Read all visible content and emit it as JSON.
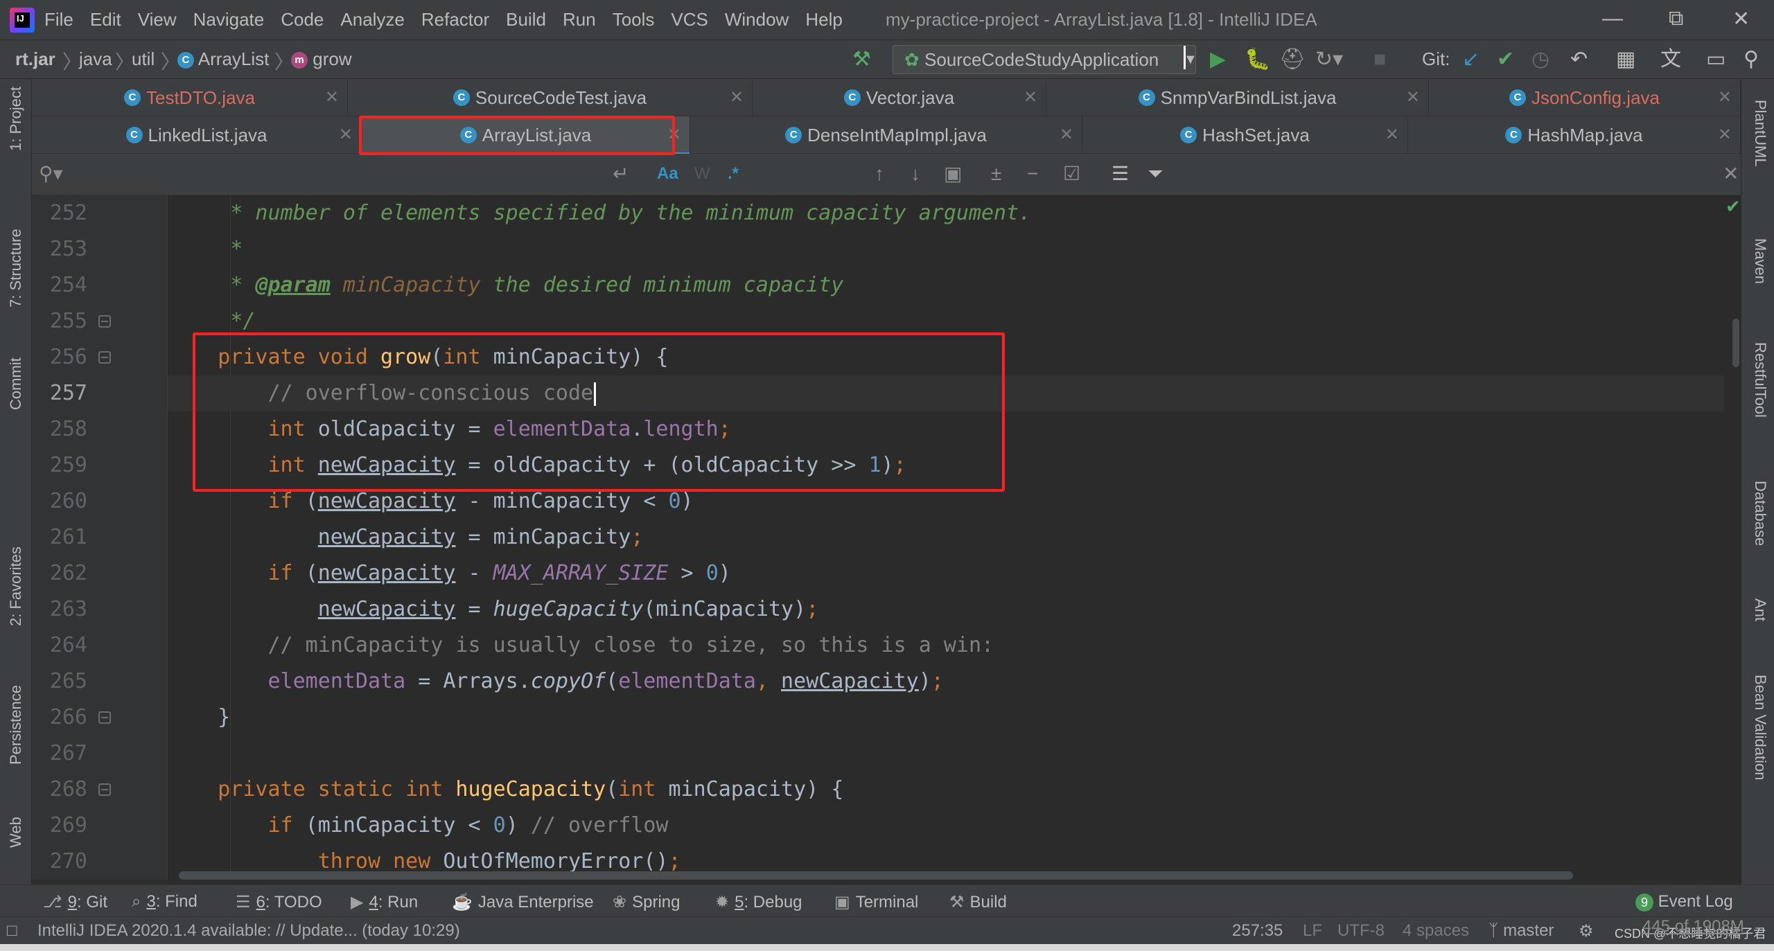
{
  "menubar": {
    "items": [
      "File",
      "Edit",
      "View",
      "Navigate",
      "Code",
      "Analyze",
      "Refactor",
      "Build",
      "Run",
      "Tools",
      "VCS",
      "Window",
      "Help"
    ],
    "window_title": "my-practice-project - ArrayList.java [1.8] - IntelliJ IDEA",
    "logo_text": "IJ"
  },
  "breadcrumb": {
    "items": [
      "rt.jar",
      "java",
      "util",
      "ArrayList",
      "grow"
    ]
  },
  "run_config": {
    "label": "SourceCodeStudyApplication"
  },
  "vcs_label": "Git:",
  "tabs_row1": [
    {
      "label": "TestDTO.java",
      "modified": true
    },
    {
      "label": "SourceCodeTest.java",
      "modified": false
    },
    {
      "label": "Vector.java",
      "modified": false
    },
    {
      "label": "SnmpVarBindList.java",
      "modified": false
    },
    {
      "label": "JsonConfig.java",
      "modified": true
    }
  ],
  "tabs_row2": [
    {
      "label": "LinkedList.java",
      "active": false
    },
    {
      "label": "ArrayList.java",
      "active": true
    },
    {
      "label": "DenseIntMapImpl.java",
      "active": false
    },
    {
      "label": "HashSet.java",
      "active": false
    },
    {
      "label": "HashMap.java",
      "active": false
    }
  ],
  "search": {
    "match_case_label": "Aa",
    "words_label": "W",
    "regex_label": ".*"
  },
  "left_tools": [
    "1: Project",
    "7: Structure",
    "Commit",
    "2: Favorites",
    "Persistence",
    "Web"
  ],
  "right_tools": [
    "PlantUML",
    "Maven",
    "RestfulTool",
    "Database",
    "Ant",
    "Bean Validation"
  ],
  "editor": {
    "current_line": 257,
    "lines": [
      {
        "no": 252,
        "tokens": [
          [
            "doc",
            "     * number of elements specified by the minimum capacity argument."
          ]
        ]
      },
      {
        "no": 253,
        "tokens": [
          [
            "doc",
            "     *"
          ]
        ]
      },
      {
        "no": 254,
        "tokens": [
          [
            "doc",
            "     * "
          ],
          [
            "tag",
            "@param"
          ],
          [
            "doc",
            " "
          ],
          [
            "param",
            "minCapacity"
          ],
          [
            "doc",
            " the desired minimum capacity"
          ]
        ]
      },
      {
        "no": 255,
        "tokens": [
          [
            "doc",
            "     */"
          ]
        ]
      },
      {
        "no": 256,
        "tokens": [
          [
            "kw",
            "    private void "
          ],
          [
            "fn",
            "grow"
          ],
          [
            "",
            "("
          ],
          [
            "kw",
            "int "
          ],
          [
            "",
            "minCapacity) {"
          ]
        ]
      },
      {
        "no": 257,
        "tokens": [
          [
            "cmt",
            "        // overflow-conscious code"
          ]
        ]
      },
      {
        "no": 258,
        "tokens": [
          [
            "kw",
            "        int "
          ],
          [
            "",
            "oldCapacity = "
          ],
          [
            "field",
            "elementData"
          ],
          [
            "",
            "."
          ],
          [
            "field",
            "length"
          ],
          [
            "kw",
            ";"
          ]
        ]
      },
      {
        "no": 259,
        "tokens": [
          [
            "kw",
            "        int "
          ],
          [
            "ul",
            "newCapacity"
          ],
          [
            "",
            " = oldCapacity + (oldCapacity >> "
          ],
          [
            "num",
            "1"
          ],
          [
            "",
            ")"
          ],
          [
            "kw",
            ";"
          ]
        ]
      },
      {
        "no": 260,
        "tokens": [
          [
            "kw",
            "        if "
          ],
          [
            "",
            "("
          ],
          [
            "ul",
            "newCapacity"
          ],
          [
            "",
            " - minCapacity < "
          ],
          [
            "num",
            "0"
          ],
          [
            "",
            ")"
          ]
        ]
      },
      {
        "no": 261,
        "tokens": [
          [
            "",
            "            "
          ],
          [
            "ul",
            "newCapacity"
          ],
          [
            "",
            " = minCapacity"
          ],
          [
            "kw",
            ";"
          ]
        ]
      },
      {
        "no": 262,
        "tokens": [
          [
            "kw",
            "        if "
          ],
          [
            "",
            "("
          ],
          [
            "ul",
            "newCapacity"
          ],
          [
            "",
            " - "
          ],
          [
            "const",
            "MAX_ARRAY_SIZE"
          ],
          [
            "",
            " > "
          ],
          [
            "num",
            "0"
          ],
          [
            "",
            ")"
          ]
        ]
      },
      {
        "no": 263,
        "tokens": [
          [
            "",
            "            "
          ],
          [
            "ul",
            "newCapacity"
          ],
          [
            "",
            " = "
          ],
          [
            "ital",
            "hugeCapacity"
          ],
          [
            "",
            "(minCapacity)"
          ],
          [
            "kw",
            ";"
          ]
        ]
      },
      {
        "no": 264,
        "tokens": [
          [
            "cmt",
            "        // minCapacity is usually close to size, so this is a win:"
          ]
        ]
      },
      {
        "no": 265,
        "tokens": [
          [
            "field",
            "        elementData"
          ],
          [
            "",
            " = Arrays."
          ],
          [
            "ital",
            "copyOf"
          ],
          [
            "",
            "("
          ],
          [
            "field",
            "elementData"
          ],
          [
            "kw",
            ", "
          ],
          [
            "ul",
            "newCapacity"
          ],
          [
            "",
            ")"
          ],
          [
            "kw",
            ";"
          ]
        ]
      },
      {
        "no": 266,
        "tokens": [
          [
            "",
            "    }"
          ]
        ]
      },
      {
        "no": 267,
        "tokens": [
          [
            "",
            ""
          ]
        ]
      },
      {
        "no": 268,
        "tokens": [
          [
            "kw",
            "    private static int "
          ],
          [
            "fn",
            "hugeCapacity"
          ],
          [
            "",
            "("
          ],
          [
            "kw",
            "int "
          ],
          [
            "",
            "minCapacity) {"
          ]
        ]
      },
      {
        "no": 269,
        "tokens": [
          [
            "kw",
            "        if "
          ],
          [
            "",
            "(minCapacity < "
          ],
          [
            "num",
            "0"
          ],
          [
            "",
            ") "
          ],
          [
            "cmt",
            "// overflow"
          ]
        ]
      },
      {
        "no": 270,
        "tokens": [
          [
            "kw",
            "            throw new "
          ],
          [
            "",
            "OutOfMemoryError()"
          ],
          [
            "kw",
            ";"
          ]
        ]
      }
    ]
  },
  "bottom_tools": [
    {
      "key": "9",
      "label": ": Git",
      "icon": "git-icon"
    },
    {
      "key": "3",
      "label": ": Find",
      "icon": "find-icon"
    },
    {
      "key": "6",
      "label": ": TODO",
      "icon": "todo-icon"
    },
    {
      "key": "4",
      "label": ": Run",
      "icon": "run-icon"
    },
    {
      "key": "",
      "label": "Java Enterprise",
      "icon": "java-enterprise-icon"
    },
    {
      "key": "",
      "label": "Spring",
      "icon": "spring-icon"
    },
    {
      "key": "5",
      "label": ": Debug",
      "icon": "debug-icon"
    },
    {
      "key": "",
      "label": "Terminal",
      "icon": "terminal-icon"
    },
    {
      "key": "",
      "label": "Build",
      "icon": "build-icon"
    }
  ],
  "event_log": {
    "count": "9",
    "label": "Event Log"
  },
  "statusbar": {
    "message": "IntelliJ IDEA 2020.1.4 available: // Update... (today 10:29)",
    "position": "257:35",
    "line_sep": "LF",
    "encoding": "UTF-8",
    "indent": "4 spaces",
    "branch": "master",
    "memory": "445 of 1908M",
    "watermark": "CSDN @不想睡觉的橘子君"
  }
}
